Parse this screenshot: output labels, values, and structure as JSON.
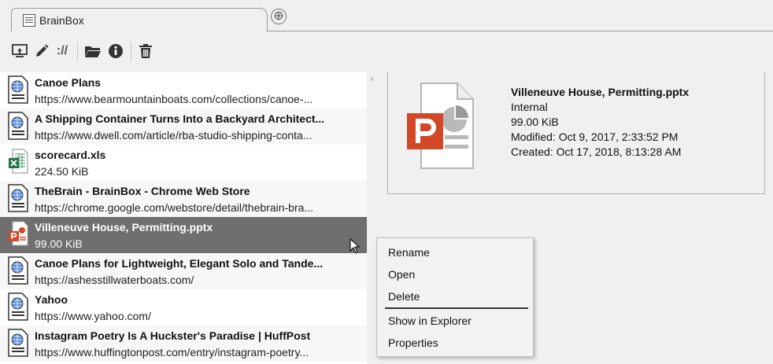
{
  "tab": {
    "label": "BrainBox",
    "add_symbol": "⊕"
  },
  "toolbar": {
    "buttons": [
      {
        "icon": "screen-capture-icon"
      },
      {
        "icon": "pencil-icon"
      },
      {
        "icon": "url-icon"
      },
      {
        "icon": "folder-icon"
      },
      {
        "icon": "info-icon"
      },
      {
        "icon": "trash-icon"
      }
    ],
    "url_text": "://"
  },
  "items": [
    {
      "icon": "web-page-icon",
      "title": "Canoe Plans",
      "subtitle": "https://www.bearmountainboats.com/collections/canoe-..."
    },
    {
      "icon": "web-page-icon",
      "title": "A Shipping Container Turns Into a Backyard Architect...",
      "subtitle": "https://www.dwell.com/article/rba-studio-shipping-conta..."
    },
    {
      "icon": "excel-file-icon",
      "title": "scorecard.xls",
      "subtitle": "224.50 KiB"
    },
    {
      "icon": "web-page-icon",
      "title": "TheBrain - BrainBox - Chrome Web Store",
      "subtitle": "https://chrome.google.com/webstore/detail/thebrain-bra..."
    },
    {
      "icon": "powerpoint-file-icon",
      "title": "Villeneuve House, Permitting.pptx",
      "subtitle": "99.00 KiB"
    },
    {
      "icon": "web-page-icon",
      "title": "Canoe Plans for Lightweight, Elegant Solo and Tande...",
      "subtitle": "https://ashesstillwaterboats.com/"
    },
    {
      "icon": "web-page-icon",
      "title": "Yahoo",
      "subtitle": "https://www.yahoo.com/"
    },
    {
      "icon": "web-page-icon",
      "title": "Instagram Poetry Is A Huckster's Paradise | HuffPost",
      "subtitle": "https://www.huffingtonpost.com/entry/instagram-poetry..."
    }
  ],
  "detail": {
    "name": "Villeneuve House, Permitting.pptx",
    "location": "Internal",
    "size": "99.00 KiB",
    "modified": "Modified: Oct 9, 2017, 2:33:52 PM",
    "created": "Created: Oct 17, 2018, 8:13:28 AM"
  },
  "context_menu": {
    "items": [
      "Rename",
      "Open",
      "Delete",
      "Show in Explorer",
      "Properties"
    ]
  },
  "colors": {
    "selected_row": "#6f6f6f",
    "powerpoint": "#d24726",
    "excel": "#217346"
  }
}
